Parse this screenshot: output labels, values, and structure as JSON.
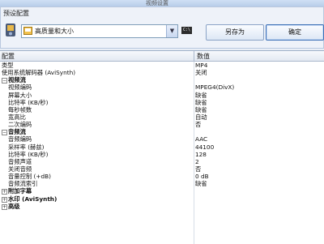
{
  "window": {
    "title": "视频设置"
  },
  "preset": {
    "legend": "预设配置",
    "selected": "高质量和大小",
    "cmd_icon_text": "C:\\",
    "save_as_label": "另存为",
    "ok_label": "确定"
  },
  "grid": {
    "col_name": "配置",
    "col_value": "数值",
    "rows": [
      {
        "kind": "top",
        "name": "类型",
        "value": "MP4"
      },
      {
        "kind": "top",
        "name": "使用系统解码器 (AviSynth)",
        "value": "关闭"
      },
      {
        "kind": "cat",
        "expander": "−",
        "name": "视频流",
        "value": ""
      },
      {
        "kind": "child",
        "name": "视频编码",
        "value": "MPEG4(DivX)"
      },
      {
        "kind": "child",
        "name": "屏幕大小",
        "value": "缺省"
      },
      {
        "kind": "child",
        "name": "比特率 (KB/秒)",
        "value": "缺省"
      },
      {
        "kind": "child",
        "name": "每秒帧数",
        "value": "缺省"
      },
      {
        "kind": "child",
        "name": "宽高比",
        "value": "自动"
      },
      {
        "kind": "child",
        "name": "二次编码",
        "value": "否"
      },
      {
        "kind": "cat",
        "expander": "−",
        "name": "音频流",
        "value": ""
      },
      {
        "kind": "child",
        "name": "音频编码",
        "value": "AAC"
      },
      {
        "kind": "child",
        "name": "采样率 (赫兹)",
        "value": "44100"
      },
      {
        "kind": "child",
        "name": "比特率 (KB/秒)",
        "value": "128"
      },
      {
        "kind": "child",
        "name": "音频声道",
        "value": "2"
      },
      {
        "kind": "child",
        "name": "关闭音频",
        "value": "否"
      },
      {
        "kind": "child",
        "name": "音量控制 (+dB)",
        "value": "0 dB"
      },
      {
        "kind": "child",
        "name": "音频流索引",
        "value": "缺省"
      },
      {
        "kind": "cat",
        "expander": "+",
        "name": "附加字幕",
        "value": ""
      },
      {
        "kind": "cat",
        "expander": "+",
        "name": "水印 (AviSynth)",
        "value": ""
      },
      {
        "kind": "cat",
        "expander": "+",
        "name": "高级",
        "value": ""
      }
    ]
  }
}
